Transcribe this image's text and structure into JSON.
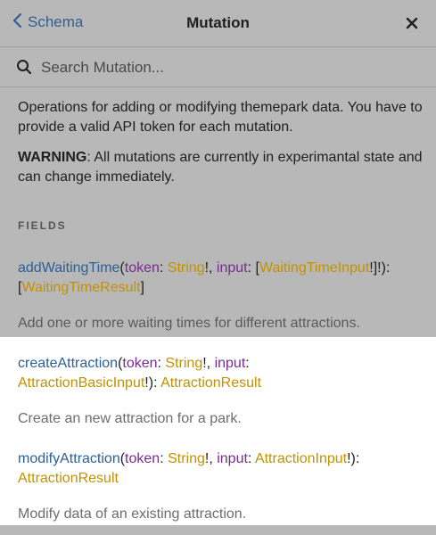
{
  "header": {
    "back_label": "Schema",
    "title": "Mutation"
  },
  "search": {
    "placeholder": "Search Mutation..."
  },
  "description": "Operations for adding or modifying themepark data. You have to provide a valid API token for each mutation.",
  "warning": {
    "label": "WARNING",
    "text": ": All mutations are currently in experimantal state and can change immediately."
  },
  "fields_heading": "FIELDS",
  "fields": [
    {
      "name": "addWaitingTime",
      "arg1": "token",
      "arg1_type": "String",
      "arg2": "input",
      "arg2_type": "WaitingTimeInput",
      "return_type": "WaitingTimeResult",
      "description": "Add one or more waiting times for different attractions."
    },
    {
      "name": "createAttraction",
      "arg1": "token",
      "arg1_type": "String",
      "arg2": "input",
      "arg2_type": "AttractionBasicInput",
      "return_type": "AttractionResult",
      "description": "Create an new attraction for a park."
    },
    {
      "name": "modifyAttraction",
      "arg1": "token",
      "arg1_type": "String",
      "arg2": "input",
      "arg2_type": "AttractionInput",
      "return_type": "AttractionResult",
      "description": "Modify data of an existing attraction."
    }
  ],
  "colors": {
    "link": "#2b5f96",
    "argument": "#7a2a92",
    "type": "#c39100",
    "overlay": "#b8b8b8"
  }
}
